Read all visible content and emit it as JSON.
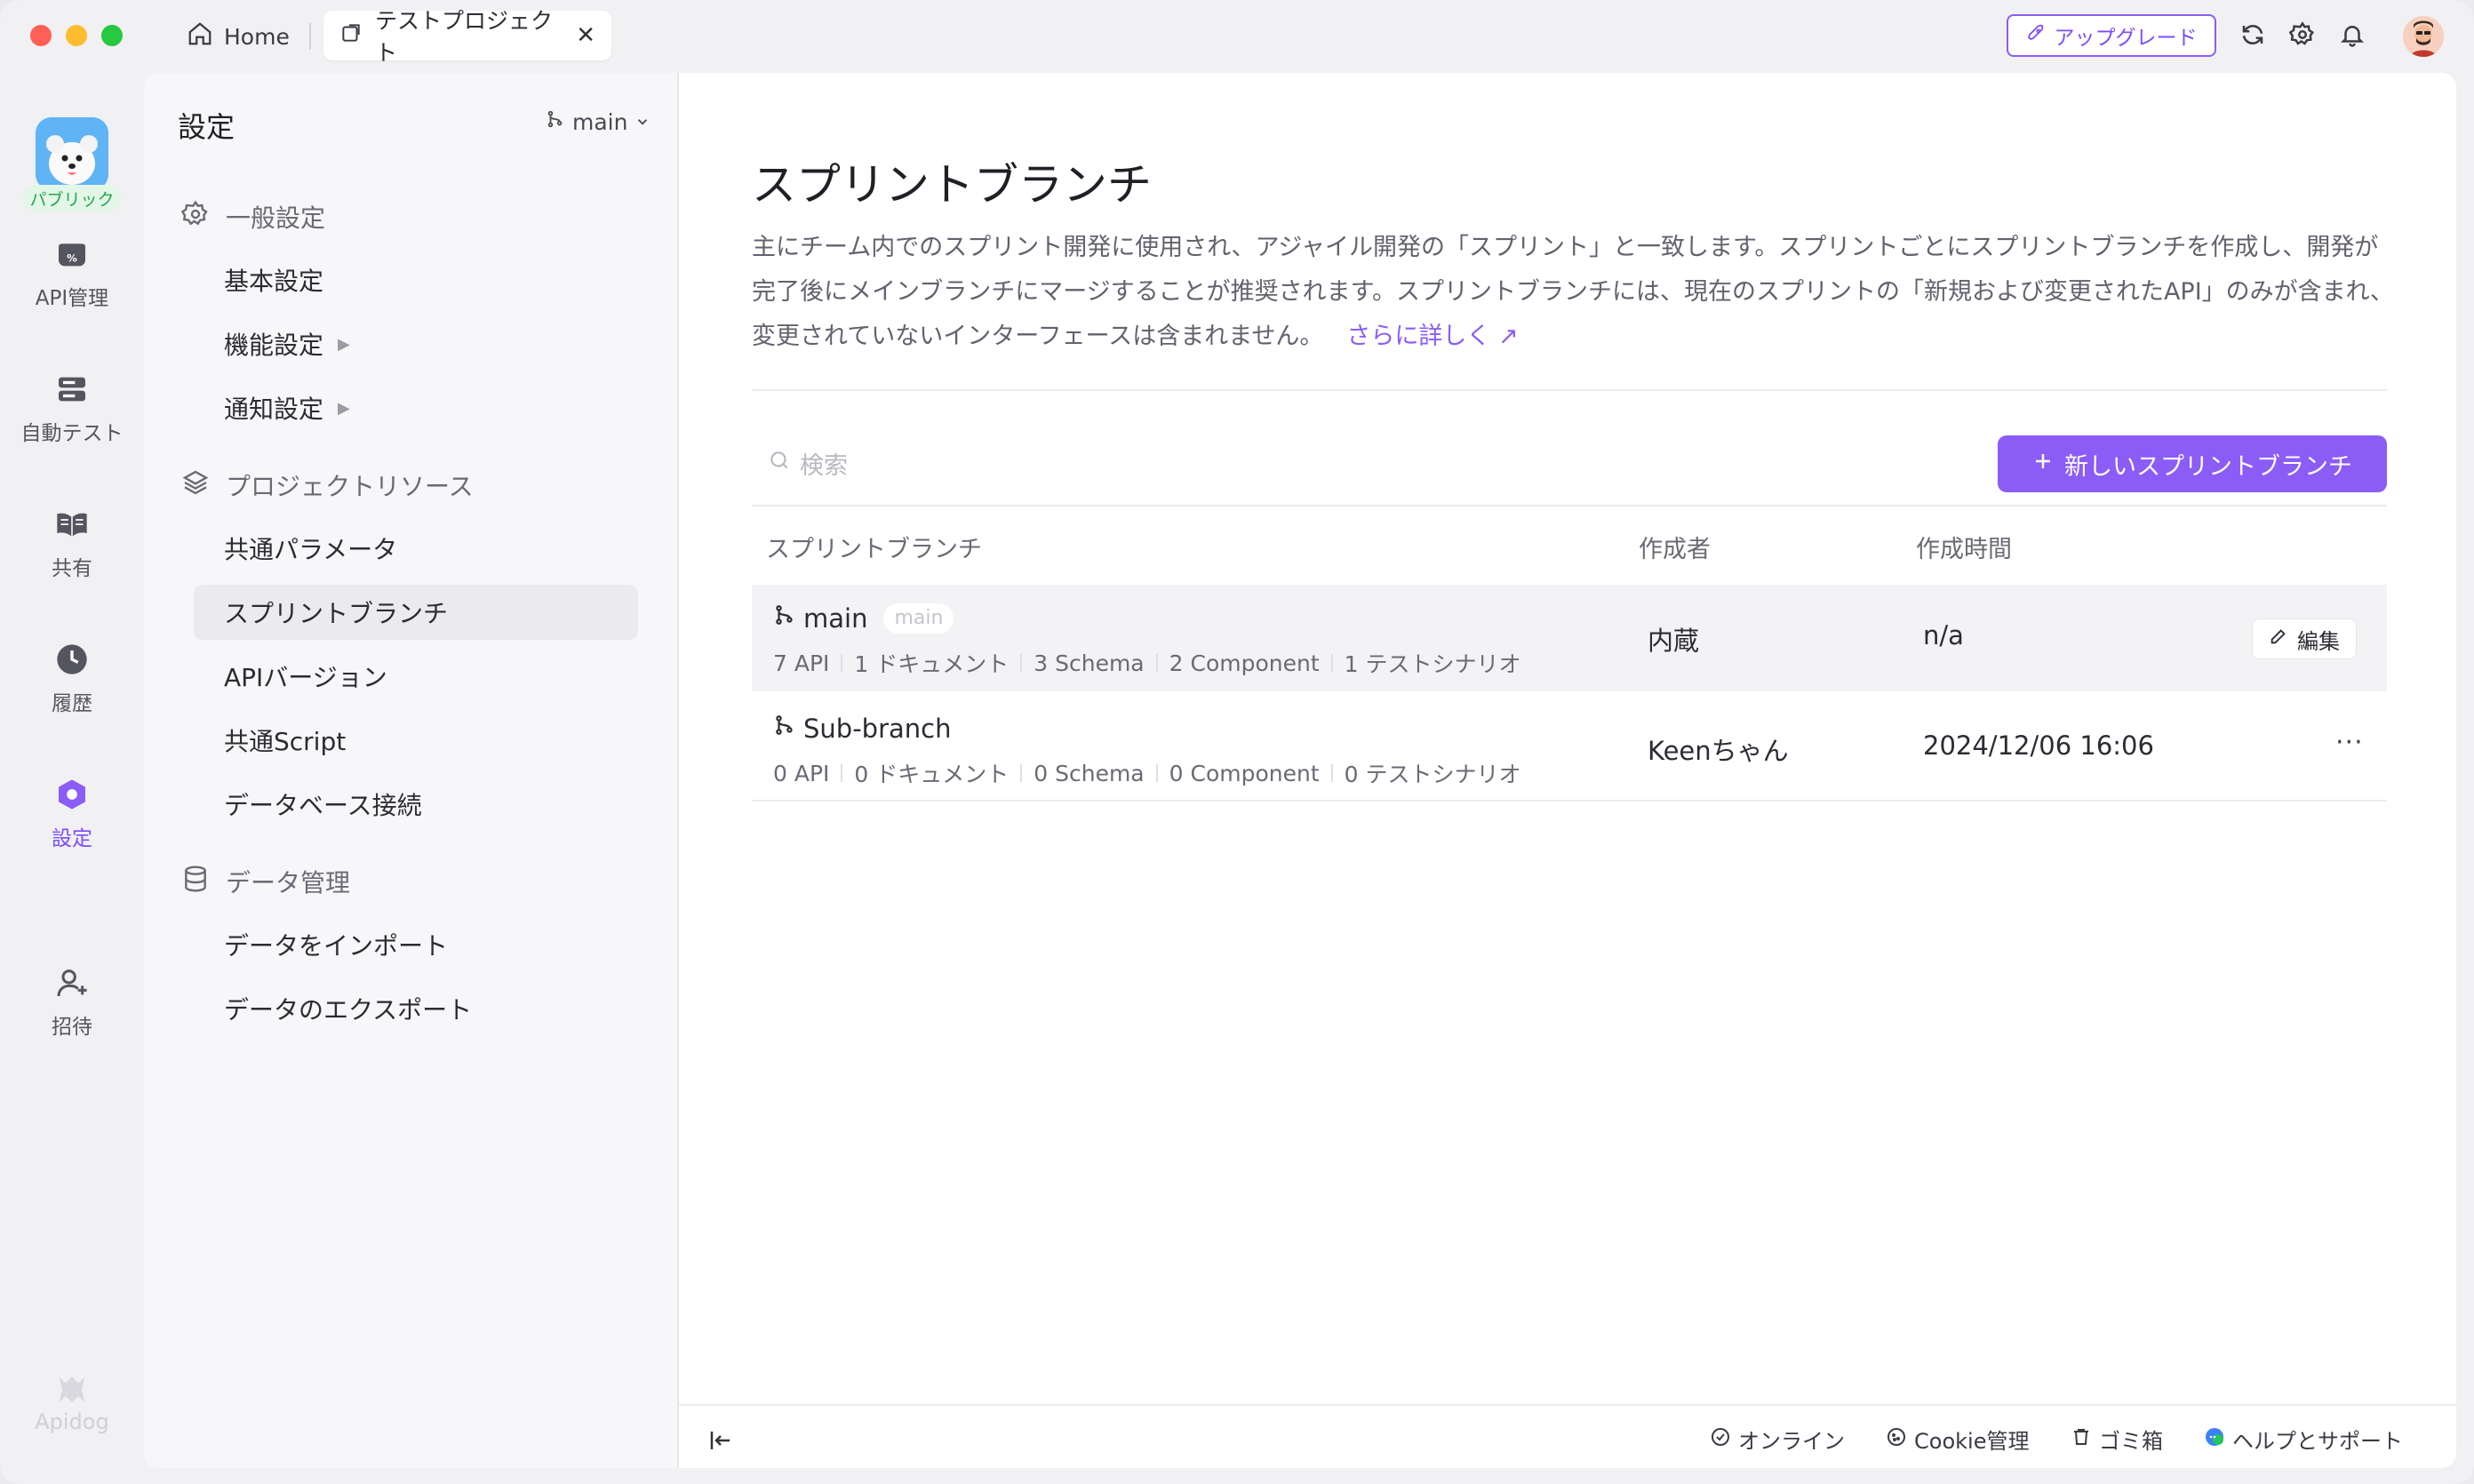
{
  "titlebar": {
    "home_label": "Home",
    "project_tab_label": "テストプロジェクト",
    "close_glyph": "✕",
    "upgrade_label": "アップグレード"
  },
  "rail": {
    "public_badge": "パブリック",
    "items": [
      {
        "label": "API管理",
        "icon": "api-icon"
      },
      {
        "label": "自動テスト",
        "icon": "test-icon"
      },
      {
        "label": "共有",
        "icon": "book-icon"
      },
      {
        "label": "履歴",
        "icon": "clock-icon"
      },
      {
        "label": "設定",
        "icon": "settings-hex-icon"
      },
      {
        "label": "招待",
        "icon": "invite-icon"
      }
    ],
    "logo_label": "Apidog"
  },
  "settings": {
    "title": "設定",
    "branch": "main",
    "general_section": "一般設定",
    "general_items": [
      "基本設定",
      "機能設定",
      "通知設定"
    ],
    "resources_section": "プロジェクトリソース",
    "resources_items": [
      "共通パラメータ",
      "スプリントブランチ",
      "APIバージョン",
      "共通Script",
      "データベース接続"
    ],
    "data_section": "データ管理",
    "data_items": [
      "データをインポート",
      "データのエクスポート"
    ]
  },
  "main": {
    "title": "スプリントブランチ",
    "description": "主にチーム内でのスプリント開発に使用され、アジャイル開発の「スプリント」と一致します。スプリントごとにスプリントブランチを作成し、開発が完了後にメインブランチにマージすることが推奨されます。スプリントブランチには、現在のスプリントの「新規および変更されたAPI」のみが含まれ、変更されていないインターフェースは含まれません。",
    "learn_more": "さらに詳しく ↗",
    "search_placeholder": "検索",
    "new_button": "新しいスプリントブランチ",
    "columns": [
      "スプリントブランチ",
      "作成者",
      "作成時間"
    ],
    "rows": [
      {
        "name": "main",
        "tag": "main",
        "stats": [
          "7 API",
          "1 ドキュメント",
          "3 Schema",
          "2 Component",
          "1 テストシナリオ"
        ],
        "creator": "内蔵",
        "time": "n/a",
        "action": "編集"
      },
      {
        "name": "Sub-branch",
        "stats": [
          "0 API",
          "0 ドキュメント",
          "0 Schema",
          "0 Component",
          "0 テストシナリオ"
        ],
        "creator": "Keenちゃん",
        "time": "2024/12/06 16:06",
        "action": "···"
      }
    ]
  },
  "footer": {
    "online": "オンライン",
    "cookie": "Cookie管理",
    "trash": "ゴミ箱",
    "help": "ヘルプとサポート"
  },
  "colors": {
    "accent": "#8b5cf6",
    "public_badge": "#23a64d"
  }
}
